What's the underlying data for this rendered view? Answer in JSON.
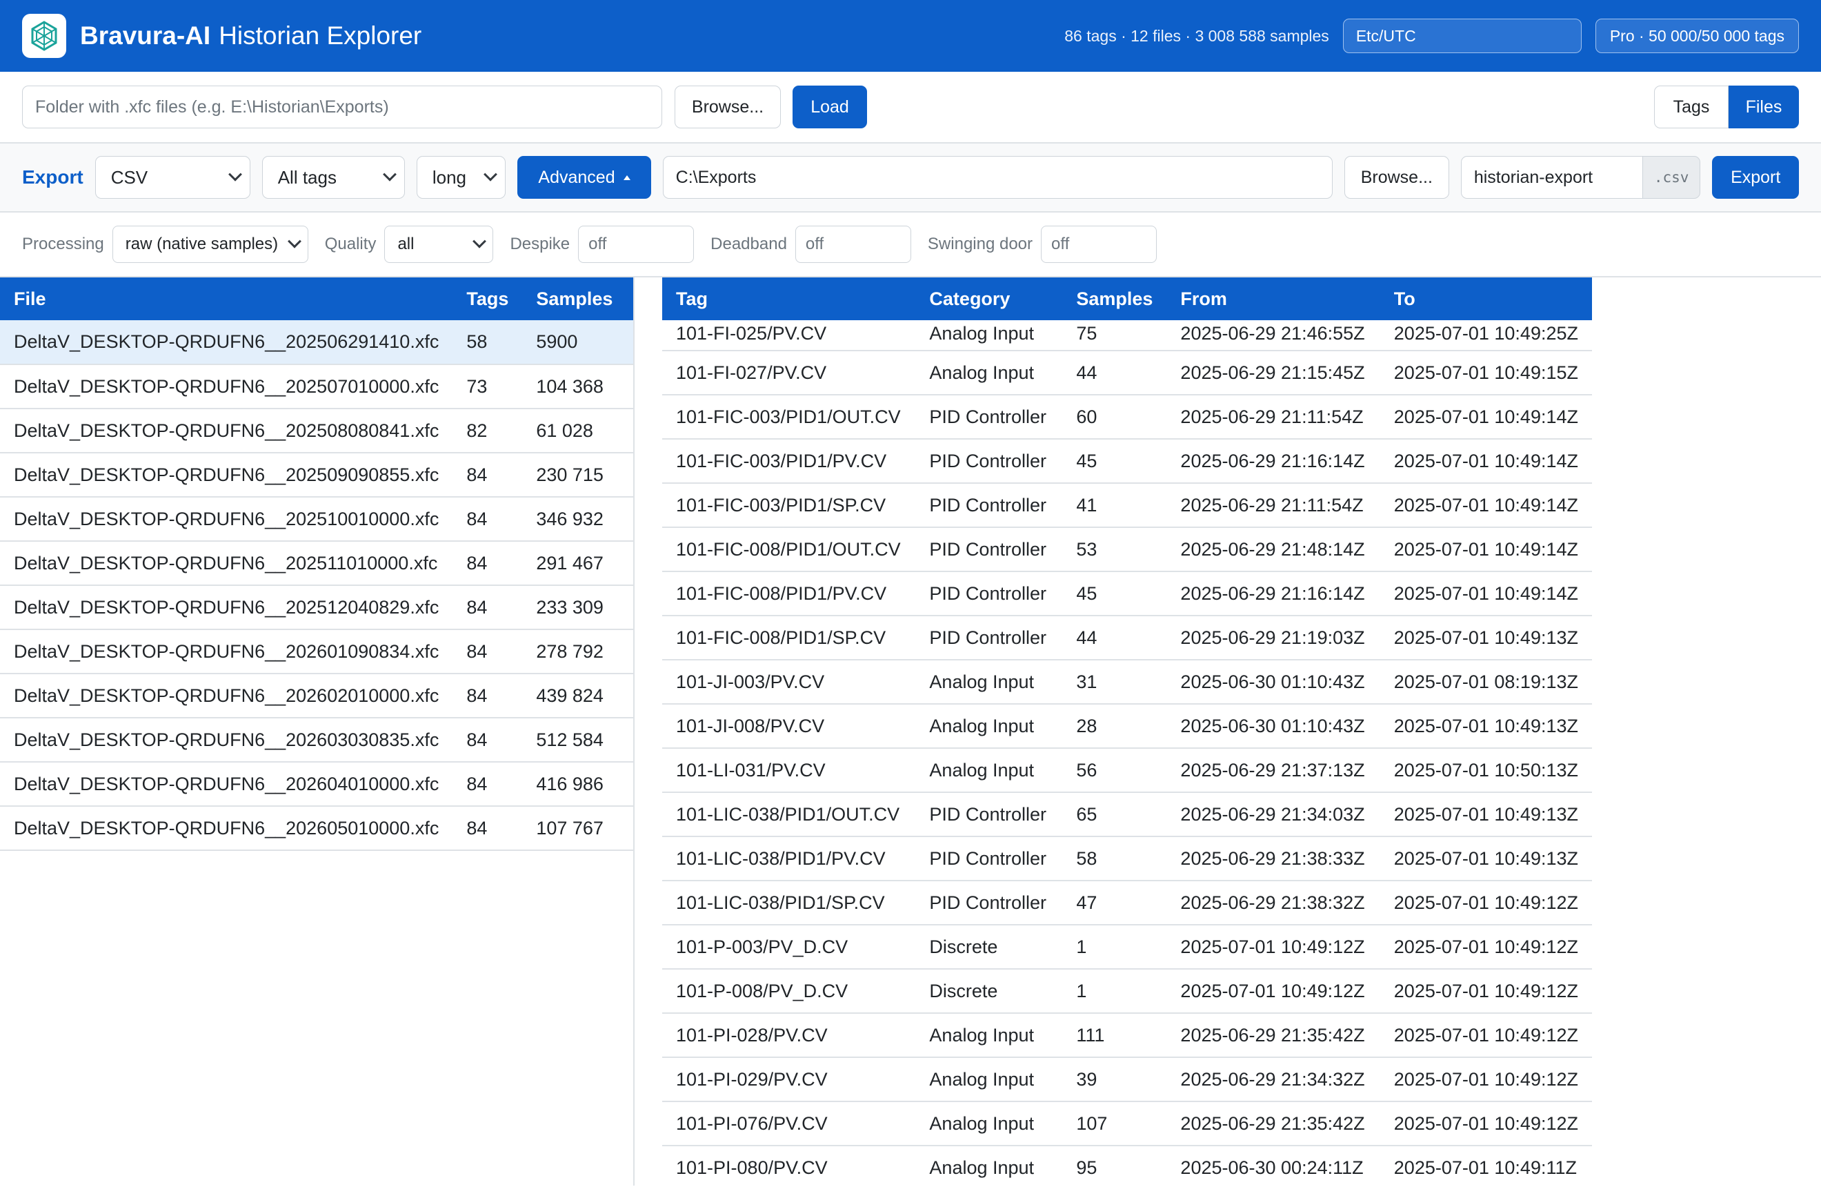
{
  "header": {
    "brand": "Bravura-AI",
    "subtitle": "Historian Explorer",
    "stats": "86 tags · 12 files · 3 008 588 samples",
    "timezone": "Etc/UTC",
    "license": "Pro · 50 000/50 000 tags"
  },
  "loader": {
    "folder_placeholder": "Folder with .xfc files (e.g. E:\\Historian\\Exports)",
    "browse_label": "Browse...",
    "load_label": "Load",
    "view_tags_label": "Tags",
    "view_files_label": "Files"
  },
  "export": {
    "label": "Export",
    "format": "CSV",
    "tag_scope": "All tags",
    "layout": "long",
    "advanced_label": "Advanced",
    "path": "C:\\Exports",
    "browse_label": "Browse...",
    "filename": "historian-export",
    "extension": ".csv",
    "export_label": "Export"
  },
  "processing": {
    "processing_label": "Processing",
    "processing_value": "raw (native samples)",
    "quality_label": "Quality",
    "quality_value": "all",
    "despike_label": "Despike",
    "despike_value": "off",
    "deadband_label": "Deadband",
    "deadband_value": "off",
    "swinging_label": "Swinging door",
    "swinging_value": "off"
  },
  "files_table": {
    "columns": [
      "File",
      "Tags",
      "Samples"
    ],
    "rows": [
      [
        "DeltaV_DESKTOP-QRDUFN6__202506291410.xfc",
        "58",
        "5900"
      ],
      [
        "DeltaV_DESKTOP-QRDUFN6__202507010000.xfc",
        "73",
        "104 368"
      ],
      [
        "DeltaV_DESKTOP-QRDUFN6__202508080841.xfc",
        "82",
        "61 028"
      ],
      [
        "DeltaV_DESKTOP-QRDUFN6__202509090855.xfc",
        "84",
        "230 715"
      ],
      [
        "DeltaV_DESKTOP-QRDUFN6__202510010000.xfc",
        "84",
        "346 932"
      ],
      [
        "DeltaV_DESKTOP-QRDUFN6__202511010000.xfc",
        "84",
        "291 467"
      ],
      [
        "DeltaV_DESKTOP-QRDUFN6__202512040829.xfc",
        "84",
        "233 309"
      ],
      [
        "DeltaV_DESKTOP-QRDUFN6__202601090834.xfc",
        "84",
        "278 792"
      ],
      [
        "DeltaV_DESKTOP-QRDUFN6__202602010000.xfc",
        "84",
        "439 824"
      ],
      [
        "DeltaV_DESKTOP-QRDUFN6__202603030835.xfc",
        "84",
        "512 584"
      ],
      [
        "DeltaV_DESKTOP-QRDUFN6__202604010000.xfc",
        "84",
        "416 986"
      ],
      [
        "DeltaV_DESKTOP-QRDUFN6__202605010000.xfc",
        "84",
        "107 767"
      ]
    ]
  },
  "tags_table": {
    "columns": [
      "Tag",
      "Category",
      "Samples",
      "From",
      "To"
    ],
    "rows": [
      [
        "101-FI-025/PV.CV",
        "Analog Input",
        "75",
        "2025-06-29 21:46:55Z",
        "2025-07-01 10:49:25Z"
      ],
      [
        "101-FI-027/PV.CV",
        "Analog Input",
        "44",
        "2025-06-29 21:15:45Z",
        "2025-07-01 10:49:15Z"
      ],
      [
        "101-FIC-003/PID1/OUT.CV",
        "PID Controller",
        "60",
        "2025-06-29 21:11:54Z",
        "2025-07-01 10:49:14Z"
      ],
      [
        "101-FIC-003/PID1/PV.CV",
        "PID Controller",
        "45",
        "2025-06-29 21:16:14Z",
        "2025-07-01 10:49:14Z"
      ],
      [
        "101-FIC-003/PID1/SP.CV",
        "PID Controller",
        "41",
        "2025-06-29 21:11:54Z",
        "2025-07-01 10:49:14Z"
      ],
      [
        "101-FIC-008/PID1/OUT.CV",
        "PID Controller",
        "53",
        "2025-06-29 21:48:14Z",
        "2025-07-01 10:49:14Z"
      ],
      [
        "101-FIC-008/PID1/PV.CV",
        "PID Controller",
        "45",
        "2025-06-29 21:16:14Z",
        "2025-07-01 10:49:14Z"
      ],
      [
        "101-FIC-008/PID1/SP.CV",
        "PID Controller",
        "44",
        "2025-06-29 21:19:03Z",
        "2025-07-01 10:49:13Z"
      ],
      [
        "101-JI-003/PV.CV",
        "Analog Input",
        "31",
        "2025-06-30 01:10:43Z",
        "2025-07-01 08:19:13Z"
      ],
      [
        "101-JI-008/PV.CV",
        "Analog Input",
        "28",
        "2025-06-30 01:10:43Z",
        "2025-07-01 10:49:13Z"
      ],
      [
        "101-LI-031/PV.CV",
        "Analog Input",
        "56",
        "2025-06-29 21:37:13Z",
        "2025-07-01 10:50:13Z"
      ],
      [
        "101-LIC-038/PID1/OUT.CV",
        "PID Controller",
        "65",
        "2025-06-29 21:34:03Z",
        "2025-07-01 10:49:13Z"
      ],
      [
        "101-LIC-038/PID1/PV.CV",
        "PID Controller",
        "58",
        "2025-06-29 21:38:33Z",
        "2025-07-01 10:49:13Z"
      ],
      [
        "101-LIC-038/PID1/SP.CV",
        "PID Controller",
        "47",
        "2025-06-29 21:38:32Z",
        "2025-07-01 10:49:12Z"
      ],
      [
        "101-P-003/PV_D.CV",
        "Discrete",
        "1",
        "2025-07-01 10:49:12Z",
        "2025-07-01 10:49:12Z"
      ],
      [
        "101-P-008/PV_D.CV",
        "Discrete",
        "1",
        "2025-07-01 10:49:12Z",
        "2025-07-01 10:49:12Z"
      ],
      [
        "101-PI-028/PV.CV",
        "Analog Input",
        "111",
        "2025-06-29 21:35:42Z",
        "2025-07-01 10:49:12Z"
      ],
      [
        "101-PI-029/PV.CV",
        "Analog Input",
        "39",
        "2025-06-29 21:34:32Z",
        "2025-07-01 10:49:12Z"
      ],
      [
        "101-PI-076/PV.CV",
        "Analog Input",
        "107",
        "2025-06-29 21:35:42Z",
        "2025-07-01 10:49:12Z"
      ],
      [
        "101-PI-080/PV.CV",
        "Analog Input",
        "95",
        "2025-06-30 00:24:11Z",
        "2025-07-01 10:49:11Z"
      ]
    ]
  },
  "colors": {
    "primary": "#0d5fc9",
    "selected_row": "#e3effb",
    "logo_accent": "#1aa39a"
  },
  "icons": {
    "logo": "app-logo-icon",
    "select_arrow": "chevron-down-icon",
    "advanced_toggle": "caret-up-icon"
  }
}
